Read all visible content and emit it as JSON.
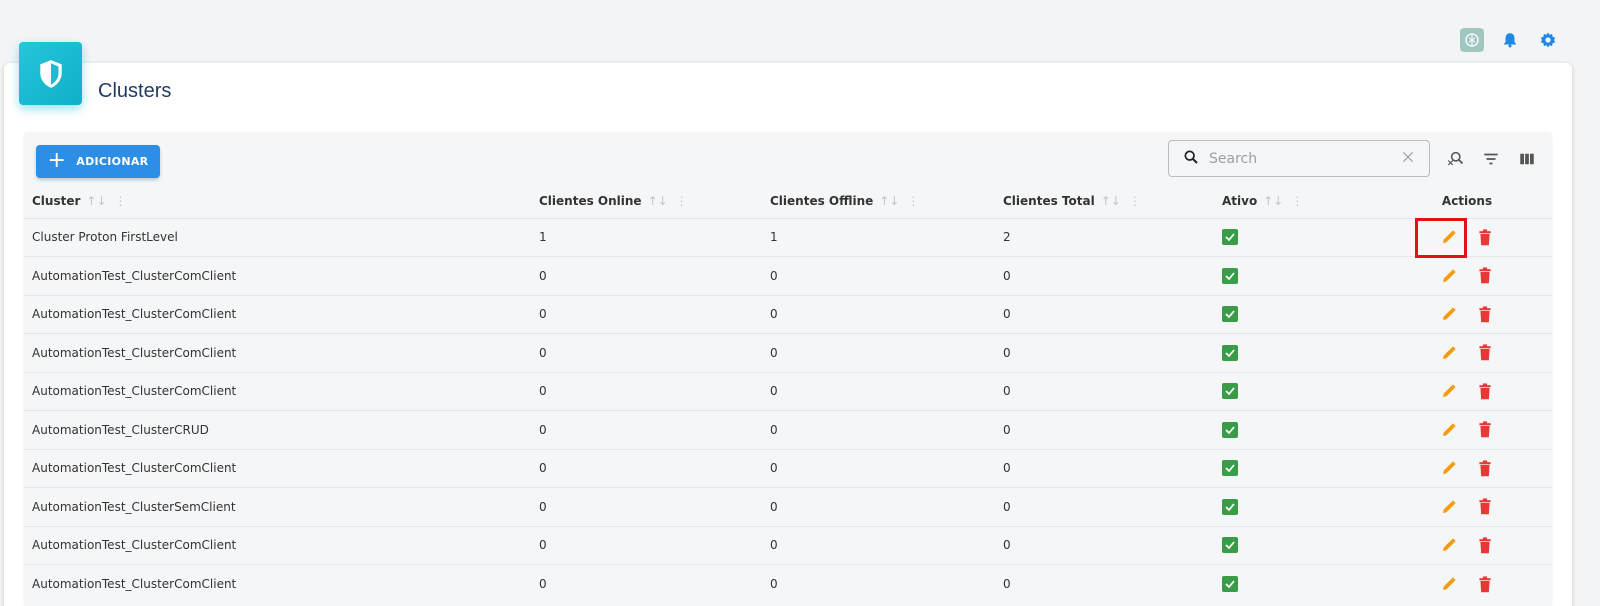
{
  "page": {
    "title": "Clusters"
  },
  "toolbar": {
    "add_label": "ADICIONAR",
    "search_placeholder": "Search",
    "search_value": ""
  },
  "table": {
    "columns": [
      "Cluster",
      "Clientes Online",
      "Clientes Offline",
      "Clientes Total",
      "Ativo",
      "Actions"
    ],
    "rows": [
      {
        "cluster": "Cluster Proton FirstLevel",
        "online": "1",
        "offline": "1",
        "total": "2",
        "ativo": true
      },
      {
        "cluster": "AutomationTest_ClusterComClient",
        "online": "0",
        "offline": "0",
        "total": "0",
        "ativo": true
      },
      {
        "cluster": "AutomationTest_ClusterComClient",
        "online": "0",
        "offline": "0",
        "total": "0",
        "ativo": true
      },
      {
        "cluster": "AutomationTest_ClusterComClient",
        "online": "0",
        "offline": "0",
        "total": "0",
        "ativo": true
      },
      {
        "cluster": "AutomationTest_ClusterComClient",
        "online": "0",
        "offline": "0",
        "total": "0",
        "ativo": true
      },
      {
        "cluster": "AutomationTest_ClusterCRUD",
        "online": "0",
        "offline": "0",
        "total": "0",
        "ativo": true
      },
      {
        "cluster": "AutomationTest_ClusterComClient",
        "online": "0",
        "offline": "0",
        "total": "0",
        "ativo": true
      },
      {
        "cluster": "AutomationTest_ClusterSemClient",
        "online": "0",
        "offline": "0",
        "total": "0",
        "ativo": true
      },
      {
        "cluster": "AutomationTest_ClusterComClient",
        "online": "0",
        "offline": "0",
        "total": "0",
        "ativo": true
      },
      {
        "cluster": "AutomationTest_ClusterComClient",
        "online": "0",
        "offline": "0",
        "total": "0",
        "ativo": true
      }
    ]
  },
  "colors": {
    "primary": "#2d8ee6",
    "header_icon": "#1bbbd1",
    "edit": "#f39c12",
    "delete": "#e53935",
    "active": "#3b9c48",
    "highlight": "#e3101a"
  },
  "icons": {
    "top": [
      "chatgpt-icon",
      "bell-icon",
      "gear-icon"
    ],
    "toolbar": [
      "search-icon",
      "clear-icon",
      "search-filter-icon",
      "filter-icon",
      "columns-icon"
    ],
    "row_actions": [
      "pencil-icon",
      "trash-icon"
    ]
  }
}
